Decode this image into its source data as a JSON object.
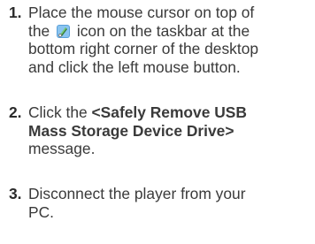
{
  "steps": [
    {
      "number": "1.",
      "text_before_icon": "Place the mouse cursor on top of",
      "line2_a": "the ",
      "line2_b": " icon on the taskbar at the",
      "line3": "bottom right corner of the desktop",
      "line4": "and click the left mouse button.",
      "icon": "safely-remove-hardware-icon"
    },
    {
      "number": "2.",
      "line1_a": "Click the ",
      "line1_bold": "<Safely Remove USB",
      "line2_bold": "Mass Storage Device Drive>",
      "line3": "message."
    },
    {
      "number": "3.",
      "line1": "Disconnect the player from your",
      "line2": "PC."
    }
  ]
}
